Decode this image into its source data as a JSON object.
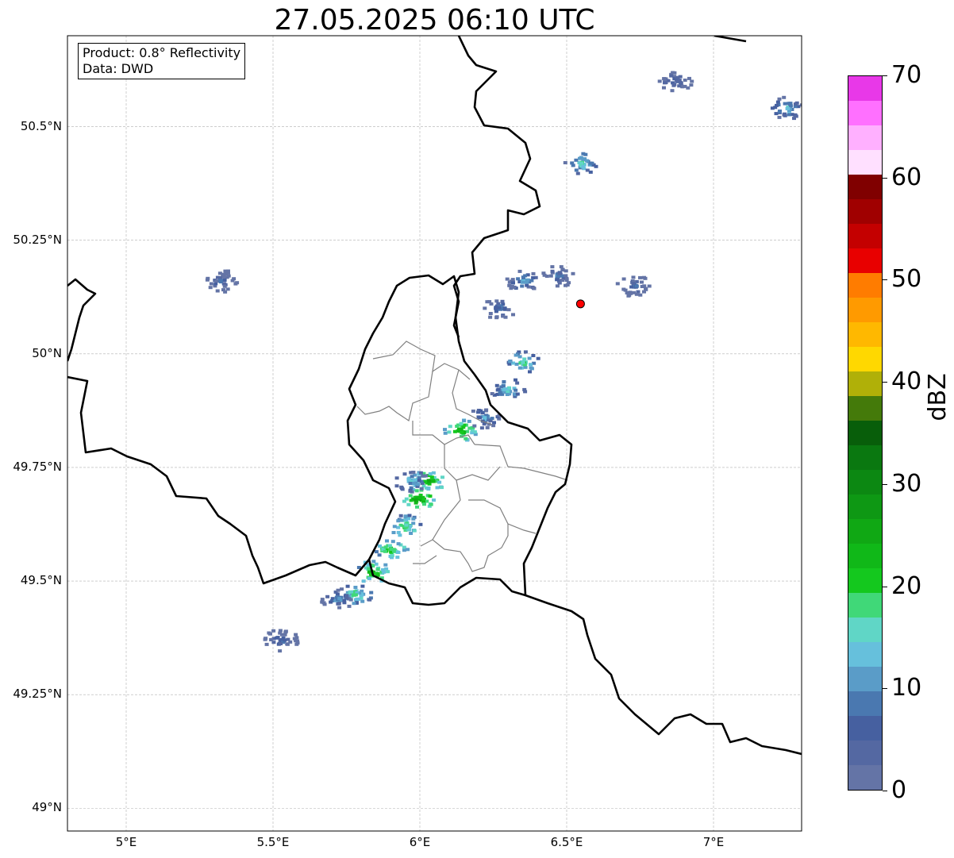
{
  "title": "27.05.2025 06:10 UTC",
  "info": {
    "product": "Product: 0.8° Reflectivity",
    "data_source": "Data: DWD"
  },
  "map": {
    "extent": {
      "lon_min": 4.8,
      "lon_max": 7.3,
      "lat_min": 48.95,
      "lat_max": 50.7
    },
    "lon_ticks": [
      {
        "v": 5.0,
        "label": "5°E"
      },
      {
        "v": 5.5,
        "label": "5.5°E"
      },
      {
        "v": 6.0,
        "label": "6°E"
      },
      {
        "v": 6.5,
        "label": "6.5°E"
      },
      {
        "v": 7.0,
        "label": "7°E"
      }
    ],
    "lat_ticks": [
      {
        "v": 50.5,
        "label": "50.5°N"
      },
      {
        "v": 50.25,
        "label": "50.25°N"
      },
      {
        "v": 50.0,
        "label": "50°N"
      },
      {
        "v": 49.75,
        "label": "49.75°N"
      },
      {
        "v": 49.5,
        "label": "49.5°N"
      },
      {
        "v": 49.25,
        "label": "49.25°N"
      },
      {
        "v": 49.0,
        "label": "49°N"
      }
    ],
    "marker": {
      "lon": 6.547,
      "lat": 50.11,
      "color": "#ff0000"
    },
    "country_color": "#000000",
    "region_color": "#808080"
  },
  "colorbar": {
    "label": "dBZ",
    "min": 0,
    "max": 70,
    "ticks": [
      "0",
      "10",
      "20",
      "30",
      "40",
      "50",
      "60",
      "70"
    ],
    "colors": [
      "#6474a6",
      "#5468a2",
      "#4660a0",
      "#4a78b0",
      "#5a9cc8",
      "#66c0dc",
      "#60d6c6",
      "#40d878",
      "#14c81e",
      "#10b818",
      "#10a814",
      "#0e9814",
      "#0c8812",
      "#0a7810",
      "#085e0a",
      "#447a0a",
      "#b0b008",
      "#ffd800",
      "#ffb800",
      "#ff9a00",
      "#ff7c00",
      "#e80000",
      "#c40000",
      "#a00000",
      "#800000",
      "#ffe0ff",
      "#ffb0ff",
      "#ff70ff",
      "#e838e8"
    ]
  },
  "echoes": [
    {
      "lon": 5.78,
      "lat": 49.47,
      "dbz": 18
    },
    {
      "lon": 5.72,
      "lat": 49.46,
      "dbz": 12
    },
    {
      "lon": 5.84,
      "lat": 49.52,
      "dbz": 24
    },
    {
      "lon": 5.9,
      "lat": 49.57,
      "dbz": 22
    },
    {
      "lon": 5.95,
      "lat": 49.62,
      "dbz": 20
    },
    {
      "lon": 6.0,
      "lat": 49.68,
      "dbz": 26
    },
    {
      "lon": 6.03,
      "lat": 49.72,
      "dbz": 24
    },
    {
      "lon": 5.97,
      "lat": 49.72,
      "dbz": 14
    },
    {
      "lon": 6.14,
      "lat": 49.83,
      "dbz": 24
    },
    {
      "lon": 6.22,
      "lat": 49.86,
      "dbz": 12
    },
    {
      "lon": 6.3,
      "lat": 49.92,
      "dbz": 16
    },
    {
      "lon": 6.35,
      "lat": 49.98,
      "dbz": 18
    },
    {
      "lon": 6.35,
      "lat": 50.16,
      "dbz": 12
    },
    {
      "lon": 6.27,
      "lat": 50.1,
      "dbz": 10
    },
    {
      "lon": 6.55,
      "lat": 50.42,
      "dbz": 16
    },
    {
      "lon": 5.32,
      "lat": 50.16,
      "dbz": 8
    },
    {
      "lon": 5.53,
      "lat": 49.37,
      "dbz": 8
    },
    {
      "lon": 6.87,
      "lat": 50.6,
      "dbz": 8
    },
    {
      "lon": 7.25,
      "lat": 50.54,
      "dbz": 14
    },
    {
      "lon": 6.47,
      "lat": 50.17,
      "dbz": 8
    },
    {
      "lon": 6.73,
      "lat": 50.15,
      "dbz": 8
    }
  ]
}
